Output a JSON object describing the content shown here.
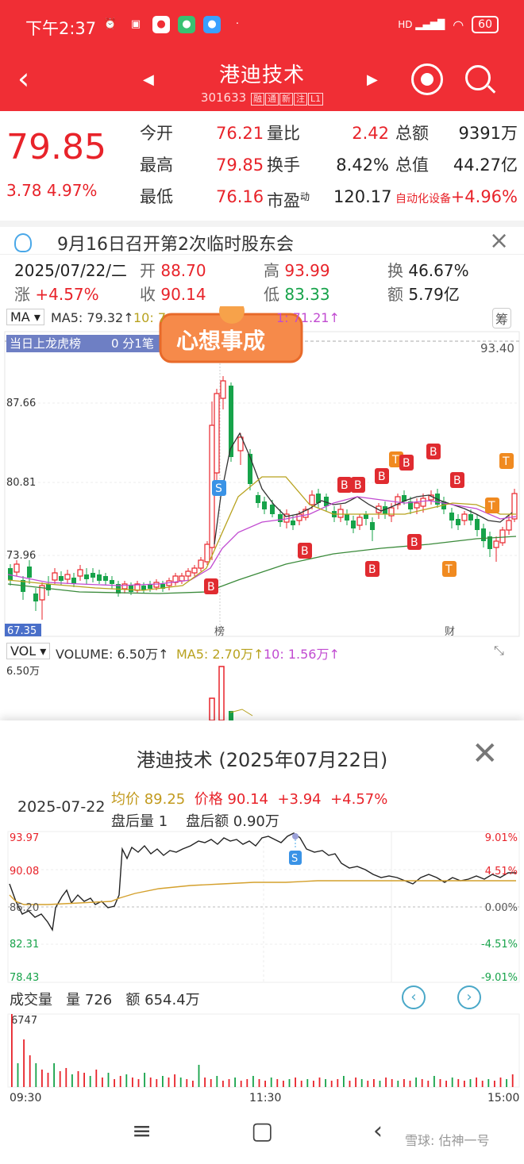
{
  "status": {
    "time": "下午2:37",
    "battery": "60",
    "network": "HD"
  },
  "header": {
    "title": "港迪技术",
    "code": "301633",
    "tags": [
      "融",
      "通",
      "新",
      "注",
      "L1"
    ]
  },
  "quote": {
    "price": "79.85",
    "change": "3.78",
    "change_pct": "4.97%",
    "rows": [
      {
        "l1": "今开",
        "v1": "76.21",
        "l2": "量比",
        "v2": "2.42",
        "l3": "总额",
        "v3": "9391万"
      },
      {
        "l1": "最高",
        "v1": "79.85",
        "l2": "换手",
        "v2": "8.42%",
        "l3": "总值",
        "v3": "44.27亿"
      },
      {
        "l1": "最低",
        "v1": "76.16",
        "l2": "市盈",
        "l2_sup": "动",
        "v2": "120.17",
        "l3": "自动化设备",
        "v3": "+4.96%"
      }
    ]
  },
  "notice": {
    "text": "9月16日召开第2次临时股东会"
  },
  "kinfo": {
    "date": "2025/07/22/二",
    "open_label": "开",
    "open": "88.70",
    "high_label": "高",
    "high": "93.99",
    "turn_label": "换",
    "turn": "46.67%",
    "chg_label": "涨",
    "chg": "+4.57%",
    "close_label": "收",
    "close": "90.14",
    "low_label": "低",
    "low": "83.33",
    "amt_label": "额",
    "amt": "5.79亿"
  },
  "ma": {
    "selector": "MA",
    "ma5": "MA5: 79.32↑",
    "ma10": "10: 7",
    "ma_tail": "1: 71.21↑",
    "chou": "筹"
  },
  "kchart": {
    "banner": "当日上龙虎榜",
    "banner2": "0 分1笔",
    "sticker": "心想事成",
    "y_labels": [
      "93.40",
      "87.66",
      "80.81",
      "73.96",
      "67.35"
    ],
    "x_marks": [
      "榜",
      "财"
    ],
    "markers": [
      "B",
      "S",
      "T"
    ]
  },
  "vol": {
    "selector": "VOL",
    "volume": "VOLUME: 6.50万↑",
    "ma5": "MA5: 2.70万↑",
    "ma10": "10: 1.56万↑",
    "top": "6.50万"
  },
  "intraday": {
    "title": "港迪技术 (2025年07月22日)",
    "date": "2025-07-22",
    "avg": "均价 89.25",
    "price": "价格 90.14",
    "chg": "+3.94",
    "pct": "+4.57%",
    "after_vol": "盘后量 1",
    "after_amt": "盘后额 0.90万",
    "y_left": [
      "93.97",
      "90.08",
      "86.20",
      "82.31",
      "78.43"
    ],
    "y_right": [
      "9.01%",
      "4.51%",
      "0.00%",
      "-4.51%",
      "-9.01%"
    ],
    "vol_label": "成交量",
    "vol_qty": "量 726",
    "vol_amt": "额 654.4万",
    "vol_top": "6747",
    "times": [
      "09:30",
      "11:30",
      "15:00"
    ]
  },
  "watermark": "雪球: 估神一号",
  "colors": {
    "brand": "#f02e35",
    "up": "#e8232a",
    "down": "#17a34a"
  }
}
